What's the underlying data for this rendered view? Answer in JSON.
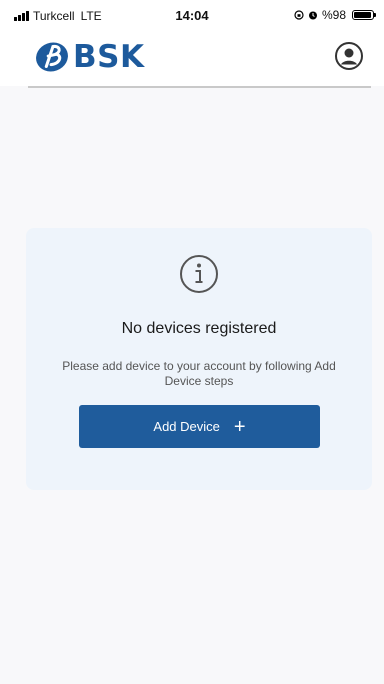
{
  "status_bar": {
    "carrier": "Turkcell",
    "network": "LTE",
    "time": "14:04",
    "battery": "%98"
  },
  "header": {
    "logo_text": "BSK",
    "profile_icon": "user-circle-icon"
  },
  "empty_state": {
    "icon": "info-circle-icon",
    "title": "No devices registered",
    "description": "Please add device to your account by following Add Device steps",
    "button_label": "Add Device",
    "button_icon": "plus-icon"
  },
  "colors": {
    "brand_blue": "#1f5c9c",
    "card_bg": "#eef4fb",
    "page_bg": "#f8f8fa"
  }
}
